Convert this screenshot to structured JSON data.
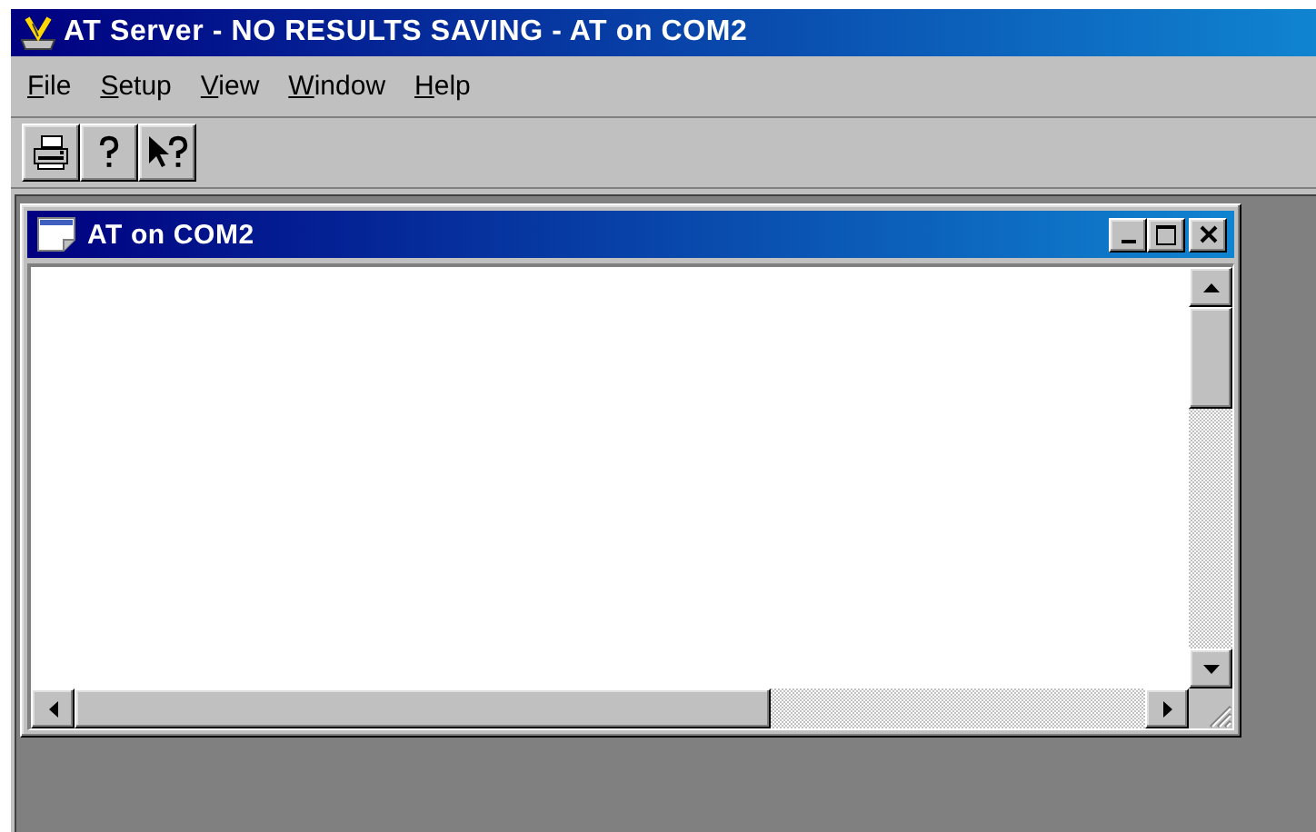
{
  "window": {
    "title": "AT Server - NO RESULTS SAVING - AT on COM2"
  },
  "menu": [
    {
      "label": "File"
    },
    {
      "label": "Setup"
    },
    {
      "label": "View"
    },
    {
      "label": "Window"
    },
    {
      "label": "Help"
    }
  ],
  "toolbar": [
    {
      "kind": "print"
    },
    {
      "kind": "help"
    },
    {
      "kind": "context-help"
    }
  ],
  "child_window": {
    "title": "AT on COM2",
    "active": true
  }
}
